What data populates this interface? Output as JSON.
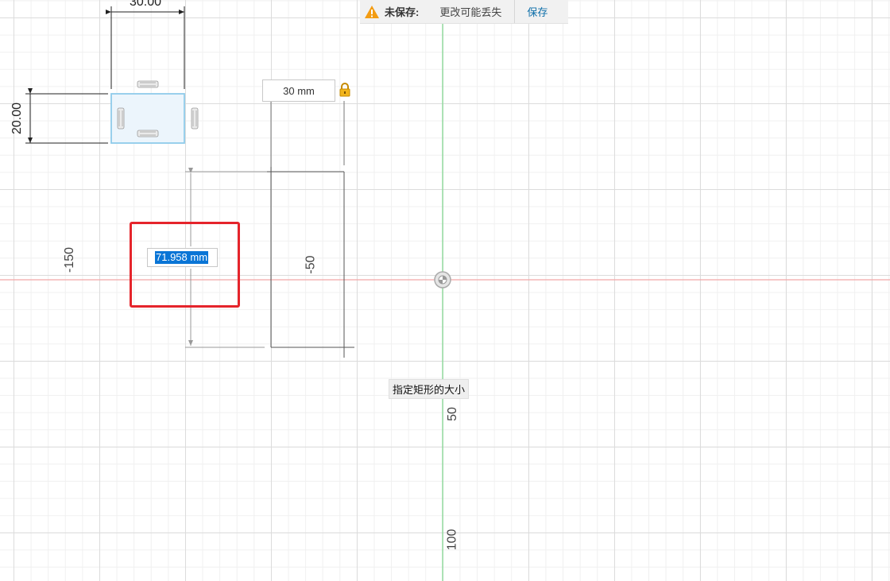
{
  "notification": {
    "warning_icon": "warning-triangle-icon",
    "title": "未保存:",
    "message": "更改可能丢失",
    "save_label": "保存"
  },
  "sketch": {
    "small_width_dim": "30.00",
    "small_height_dim": "20.00",
    "width_input_value": "30 mm",
    "lock_icon": "lock-icon",
    "height_input_value": "71.958 mm",
    "tooltip": "指定矩形的大小"
  },
  "axis_labels": {
    "x_neg150": "-150",
    "x_neg50": "-50",
    "y_50": "50",
    "y_100": "100"
  },
  "colors": {
    "x_axis": "#f2a7a7",
    "y_axis": "#7fd88e",
    "selection": "#0a75d6",
    "highlight": "#e5242b",
    "warning": "#f39c12",
    "link": "#0d6ea9"
  }
}
